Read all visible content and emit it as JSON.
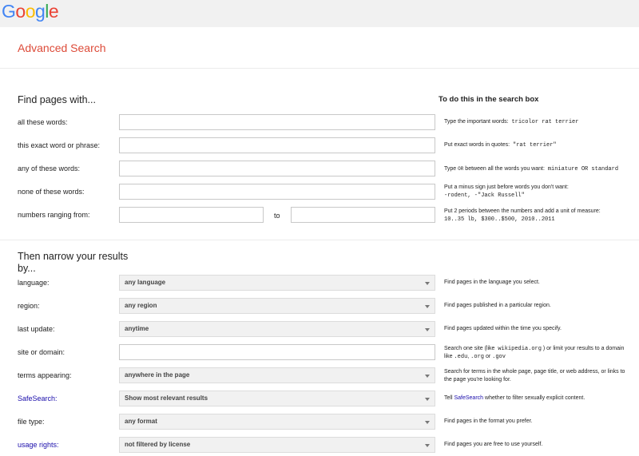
{
  "header": {
    "logo_letters": [
      "G",
      "o",
      "o",
      "g",
      "l",
      "e"
    ],
    "logo_colors": [
      "#4285f4",
      "#ea4335",
      "#fbbc05",
      "#4285f4",
      "#34a853",
      "#ea4335"
    ],
    "title": "Advanced Search"
  },
  "find_section": {
    "title": "Find pages with...",
    "right_title": "To do this in the search box",
    "all_words": {
      "label": "all these words:",
      "value": "",
      "hint_text": "Type the important words:",
      "hint_example": "tricolor rat terrier"
    },
    "exact_phrase": {
      "label": "this exact word or phrase:",
      "value": "",
      "hint_text": "Put exact words in quotes:",
      "hint_example": "\"rat terrier\""
    },
    "any_words": {
      "label": "any of these words:",
      "value": "",
      "hint_pre": "Type",
      "hint_or": "OR",
      "hint_text": "between all the words you want:",
      "hint_example": "miniature OR standard"
    },
    "none_words": {
      "label": "none of these words:",
      "value": "",
      "hint_line1": "Put a minus sign just before words you don't want:",
      "hint_example": "-rodent, -\"Jack Russell\""
    },
    "numbers_range": {
      "label": "numbers ranging from:",
      "from_value": "",
      "to_label": "to",
      "to_value": "",
      "hint_line1": "Put 2 periods between the numbers and add a unit of measure:",
      "hint_example": "10..35 lb, $300..$500, 2010..2011"
    }
  },
  "narrow_section": {
    "title_line1": "Then narrow your results",
    "title_line2": "by...",
    "language": {
      "label": "language:",
      "value": "any language",
      "hint": "Find pages in the language you select."
    },
    "region": {
      "label": "region:",
      "value": "any region",
      "hint": "Find pages published in a particular region."
    },
    "last_update": {
      "label": "last update:",
      "value": "anytime",
      "hint": "Find pages updated within the time you specify."
    },
    "site_domain": {
      "label": "site or domain:",
      "value": "",
      "hint_pre": "Search one site (like",
      "hint_ex1": "wikipedia.org",
      "hint_mid": ") or limit your results to a domain",
      "hint_like": "like",
      "hint_ex2": ".edu",
      "hint_ex3": ".org",
      "hint_or": "or",
      "hint_ex4": ".gov"
    },
    "terms_appearing": {
      "label": "terms appearing:",
      "value": "anywhere in the page",
      "hint_line1": "Search for terms in the whole page, page title, or web address, or links to",
      "hint_line2": "the page you're looking for."
    },
    "safesearch": {
      "label": "SafeSearch:",
      "value": "Show most relevant results",
      "hint_pre": "Tell",
      "hint_link": "SafeSearch",
      "hint_post": "whether to filter sexually explicit content."
    },
    "file_type": {
      "label": "file type:",
      "value": "any format",
      "hint": "Find pages in the format you prefer."
    },
    "usage_rights": {
      "label": "usage rights:",
      "value": "not filtered by license",
      "hint": "Find pages you are free to use yourself."
    }
  }
}
